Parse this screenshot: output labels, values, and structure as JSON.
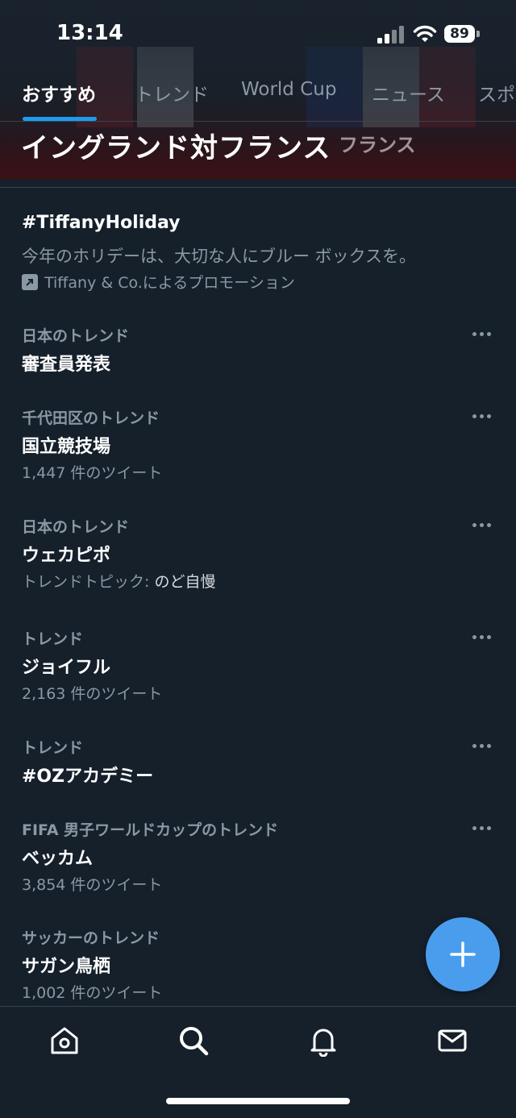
{
  "status_bar": {
    "time": "13:14",
    "battery": "89"
  },
  "tabs": [
    {
      "label": "おすすめ",
      "active": true
    },
    {
      "label": "トレンド",
      "active": false
    },
    {
      "label": "World Cup",
      "active": false
    },
    {
      "label": "ニュース",
      "active": false
    },
    {
      "label": "スポ",
      "active": false
    }
  ],
  "hero": {
    "title": "イングランド対フランス",
    "subtitle": "フランス"
  },
  "promoted": {
    "tag": "#TiffanyHoliday",
    "description": "今年のホリデーは、大切な人にブルー ボックスを。",
    "by": "Tiffany & Co.によるプロモーション"
  },
  "trends": [
    {
      "context": "日本のトレンド",
      "name": "審査員発表",
      "meta": "",
      "meta_label": "",
      "meta_value": ""
    },
    {
      "context": "千代田区のトレンド",
      "name": "国立競技場",
      "meta": "1,447 件のツイート",
      "meta_label": "",
      "meta_value": ""
    },
    {
      "context": "日本のトレンド",
      "name": "ウェカピポ",
      "meta": "",
      "meta_label": "トレンドトピック:",
      "meta_value": "のど自慢"
    },
    {
      "context": "トレンド",
      "name": "ジョイフル",
      "meta": "2,163 件のツイート",
      "meta_label": "",
      "meta_value": ""
    },
    {
      "context": "トレンド",
      "name": "#OZアカデミー",
      "meta": "",
      "meta_label": "",
      "meta_value": ""
    },
    {
      "context": "FIFA 男子ワールドカップのトレンド",
      "name": "ベッカム",
      "meta": "3,854 件のツイート",
      "meta_label": "",
      "meta_value": ""
    },
    {
      "context": "サッカーのトレンド",
      "name": "サガン鳥栖",
      "meta": "1,002 件のツイート",
      "meta_label": "",
      "meta_value": ""
    }
  ],
  "bottom_nav": [
    {
      "icon": "home-icon"
    },
    {
      "icon": "search-icon"
    },
    {
      "icon": "bell-icon"
    },
    {
      "icon": "mail-icon"
    }
  ],
  "colors": {
    "background": "#15202b",
    "accent": "#1d9bf0",
    "fab": "#4a9ded",
    "muted": "#8b98a5"
  }
}
